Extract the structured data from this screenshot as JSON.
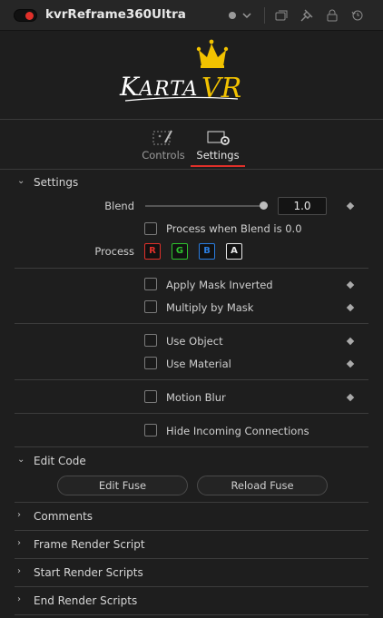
{
  "header": {
    "title": "kvrReframe360Ultra",
    "power_color": "#e0302a",
    "icons": [
      "version-dot-icon",
      "chevron-down-icon",
      "copy-icon",
      "pin-icon",
      "lock-icon",
      "reset-icon"
    ]
  },
  "logo": {
    "text": "KARTAVR",
    "crown_color": "#f2c200",
    "vr_color": "#f2c200",
    "karta_color": "#ffffff"
  },
  "tabs": [
    {
      "label": "Controls",
      "active": false
    },
    {
      "label": "Settings",
      "active": true
    }
  ],
  "accent_color": "#e0302a",
  "settings": {
    "section_label": "Settings",
    "blend_label": "Blend",
    "blend_value": "1.0",
    "blend_fraction": 1.0,
    "process_blend_zero": "Process when Blend is 0.0",
    "process_label": "Process",
    "channels": [
      {
        "label": "R",
        "color": "#e0302a"
      },
      {
        "label": "G",
        "color": "#2ec42e"
      },
      {
        "label": "B",
        "color": "#2a7de0"
      },
      {
        "label": "A",
        "color": "#e8e8e8"
      }
    ],
    "apply_mask_inverted": "Apply Mask Inverted",
    "multiply_by_mask": "Multiply by Mask",
    "use_object": "Use Object",
    "use_material": "Use Material",
    "motion_blur": "Motion Blur",
    "hide_incoming": "Hide Incoming Connections"
  },
  "edit_code": {
    "section_label": "Edit Code",
    "edit_fuse": "Edit Fuse",
    "reload_fuse": "Reload Fuse"
  },
  "collapsed_sections": [
    "Comments",
    "Frame Render Script",
    "Start Render Scripts",
    "End Render Scripts"
  ]
}
